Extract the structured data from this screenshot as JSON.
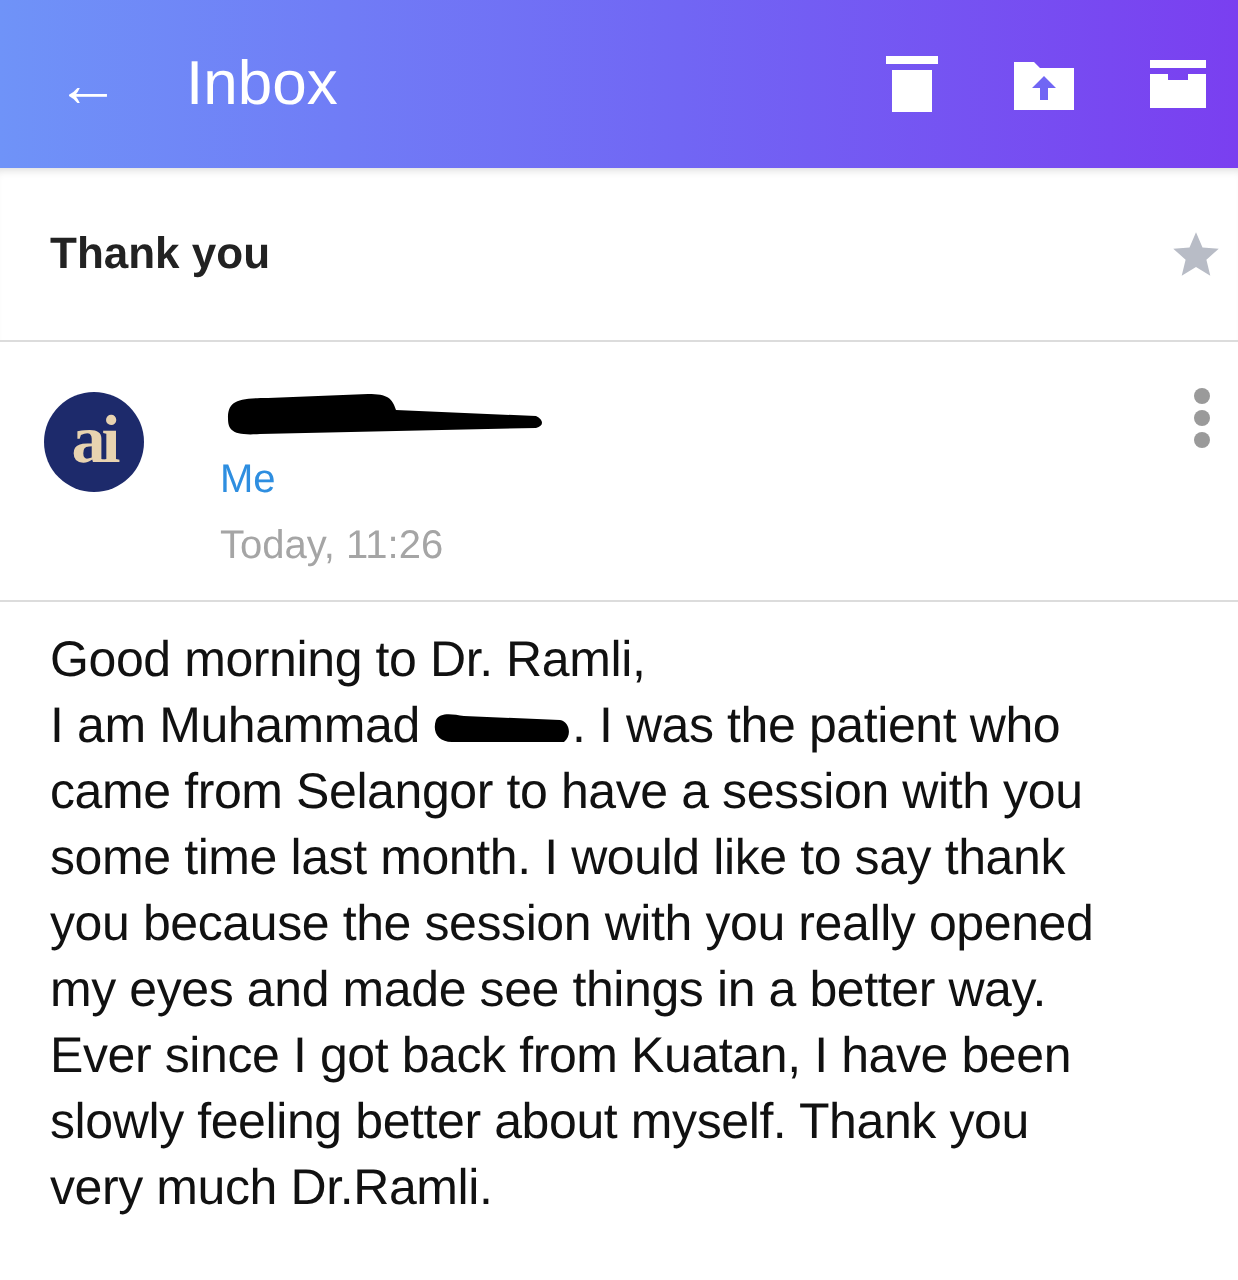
{
  "header": {
    "back_icon": "←",
    "title": "Inbox"
  },
  "subject": {
    "text": "Thank you",
    "starred": false
  },
  "message": {
    "avatar_text": "ai",
    "recipient": "Me",
    "time": "Today, 11:26"
  },
  "body": {
    "lines": [
      {
        "text": "Good morning to Dr. Ramli,"
      },
      {
        "text": "I am Muhammad",
        "redacted_after": true,
        "rest": ". I was the patient who"
      },
      {
        "text": "came from Selangor to have a session with you"
      },
      {
        "text": "some time last month. I would like to say thank"
      },
      {
        "text": "you because the session with you really opened"
      },
      {
        "text": "my eyes and made see things in a better way."
      },
      {
        "text": "Ever since I got back from Kuatan, I have been"
      },
      {
        "text": "slowly feeling better about myself. Thank you"
      },
      {
        "text": "very much Dr.Ramli."
      }
    ]
  }
}
